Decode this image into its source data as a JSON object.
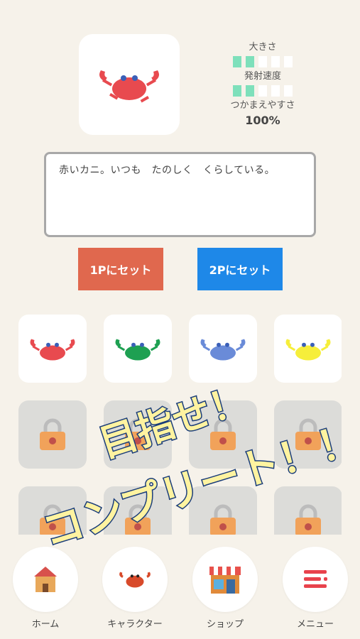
{
  "preview": {
    "character": "red-crab-icon"
  },
  "stats": {
    "size_label": "大きさ",
    "size_level": 2,
    "fire_rate_label": "発射速度",
    "fire_rate_level": 2,
    "catch_label": "つかまえやすさ",
    "catch_value": "100%"
  },
  "description": "赤いカニ。いつも　たのしく　くらしている。",
  "buttons": {
    "set_1p": "1Pにセット",
    "set_2p": "2Pにセット"
  },
  "colors": {
    "red": "#e84a4f",
    "green": "#1ea052",
    "blue": "#6a8bd8",
    "yellow": "#f6ee3a",
    "bar_on": "#7ee0bb",
    "btn_1p": "#e0684e",
    "btn_2p": "#1e88e8"
  },
  "characters": [
    {
      "name": "red-crab",
      "color": "#e84a4f",
      "locked": false
    },
    {
      "name": "green-crab",
      "color": "#1ea052",
      "locked": false
    },
    {
      "name": "blue-crab",
      "color": "#6a8bd8",
      "locked": false
    },
    {
      "name": "yellow-crab",
      "color": "#f6ee3a",
      "locked": false
    },
    {
      "locked": true
    },
    {
      "locked": true
    },
    {
      "locked": true
    },
    {
      "locked": true
    },
    {
      "locked": true
    },
    {
      "locked": true
    },
    {
      "locked": true
    },
    {
      "locked": true
    }
  ],
  "banner": {
    "line1": "目指せ！",
    "line2": "コンプリート！！"
  },
  "nav": {
    "home": "ホーム",
    "character": "キャラクター",
    "shop": "ショップ",
    "menu": "メニュー"
  }
}
